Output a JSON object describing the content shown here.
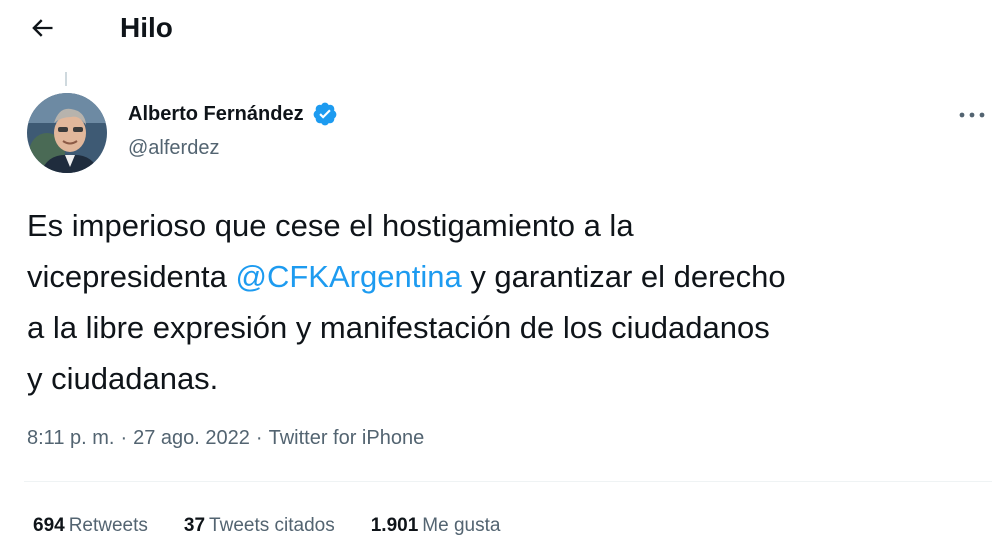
{
  "header": {
    "title": "Hilo",
    "back_icon": "arrow-left-icon"
  },
  "author": {
    "name": "Alberto Fernández",
    "handle": "@alferdez",
    "verified_icon": "verified-badge-icon",
    "verified_color": "#1d9bf0"
  },
  "more_icon": "more-horizontal-icon",
  "tweet": {
    "line1": "Es imperioso que cese el hostigamiento a la",
    "line2_before": "vicepresidenta ",
    "mention": "@CFKArgentina",
    "line2_after": " y garantizar el derecho",
    "line3": "a la libre expresión y manifestación de los ciudadanos",
    "line4": "y ciudadanas."
  },
  "meta": {
    "time": "8:11 p. m.",
    "sep": "·",
    "date": "27 ago. 2022",
    "source": "Twitter for iPhone"
  },
  "stats": [
    {
      "count": "694",
      "label": "Retweets"
    },
    {
      "count": "37",
      "label": "Tweets citados"
    },
    {
      "count": "1.901",
      "label": "Me gusta"
    }
  ],
  "colors": {
    "text": "#0f1419",
    "secondary": "#536471",
    "link": "#1d9bf0",
    "divider": "#eff3f4"
  }
}
